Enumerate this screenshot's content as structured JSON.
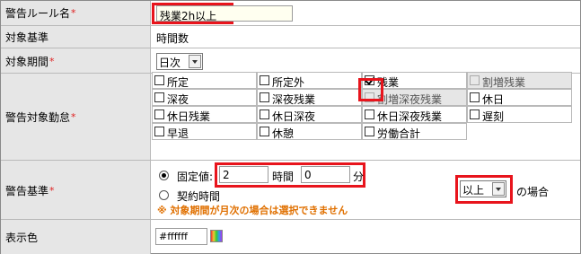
{
  "rule_name": {
    "label": "警告ルール名",
    "required_mark": "*",
    "value": "残業2h以上"
  },
  "target_basis": {
    "label": "対象基準",
    "value": "時間数"
  },
  "target_period": {
    "label": "対象期間",
    "required_mark": "*",
    "selected": "日次"
  },
  "warning_attendance": {
    "label": "警告対象勤怠",
    "required_mark": "*",
    "items": [
      {
        "label": "所定",
        "checked": false,
        "enabled": true
      },
      {
        "label": "所定外",
        "checked": false,
        "enabled": true
      },
      {
        "label": "残業",
        "checked": true,
        "enabled": true
      },
      {
        "label": "割増残業",
        "checked": false,
        "enabled": false
      },
      {
        "label": "深夜",
        "checked": false,
        "enabled": true
      },
      {
        "label": "深夜残業",
        "checked": false,
        "enabled": true
      },
      {
        "label": "割増深夜残業",
        "checked": false,
        "enabled": false
      },
      {
        "label": "休日",
        "checked": false,
        "enabled": true
      },
      {
        "label": "休日残業",
        "checked": false,
        "enabled": true
      },
      {
        "label": "休日深夜",
        "checked": false,
        "enabled": true
      },
      {
        "label": "休日深夜残業",
        "checked": false,
        "enabled": true
      },
      {
        "label": "遅刻",
        "checked": false,
        "enabled": true
      },
      {
        "label": "早退",
        "checked": false,
        "enabled": true
      },
      {
        "label": "休憩",
        "checked": false,
        "enabled": true
      },
      {
        "label": "労働合計",
        "checked": false,
        "enabled": true
      }
    ]
  },
  "warning_criteria": {
    "label": "警告基準",
    "required_mark": "*",
    "fixed_label": "固定値:",
    "hours_value": "2",
    "hours_unit": "時間",
    "minutes_value": "0",
    "minutes_unit": "分",
    "contract_label": "契約時間",
    "note": "※ 対象期間が月次の場合は選択できません",
    "comparison_selected": "以上",
    "case_suffix": "の場合"
  },
  "display_color": {
    "label": "表示色",
    "value": "#ffffff"
  },
  "colors": {
    "label_bg": "#e6e6e6",
    "highlight": "#e8141c",
    "note": "#e07000",
    "required": "#e02020"
  }
}
